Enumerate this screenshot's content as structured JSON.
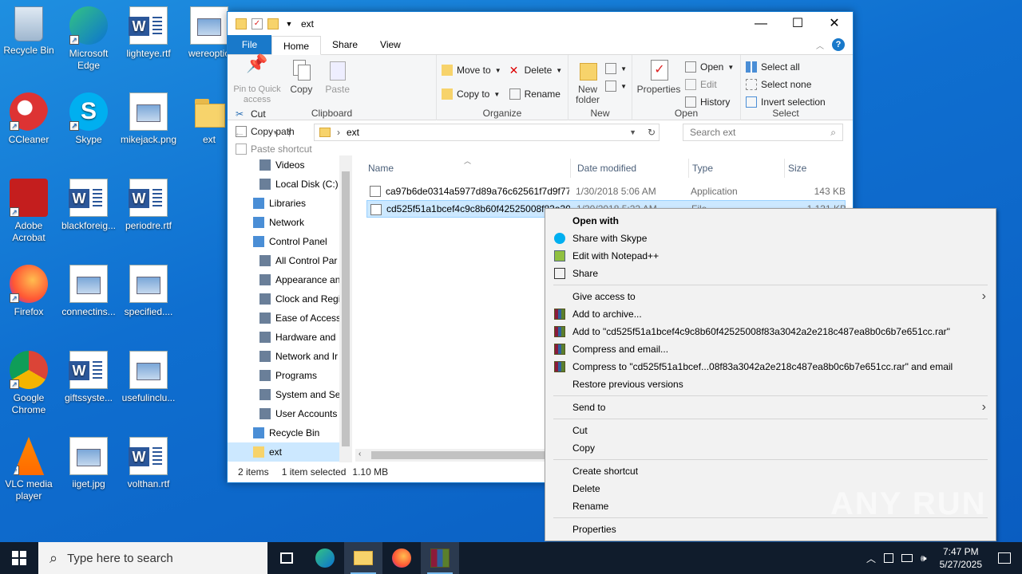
{
  "desktop": {
    "icons": [
      {
        "label": "Recycle Bin",
        "icon": "recycle-bin-icon"
      },
      {
        "label": "Microsoft Edge",
        "icon": "edge-icon"
      },
      {
        "label": "lighteye.rtf",
        "icon": "word-doc-icon"
      },
      {
        "label": "wereoptio",
        "icon": "image-file-icon"
      },
      {
        "label": "CCleaner",
        "icon": "ccleaner-icon"
      },
      {
        "label": "Skype",
        "icon": "skype-icon"
      },
      {
        "label": "mikejack.png",
        "icon": "image-file-icon"
      },
      {
        "label": "ext",
        "icon": "folder-icon"
      },
      {
        "label": "Adobe Acrobat",
        "icon": "acrobat-icon"
      },
      {
        "label": "blackforeig...",
        "icon": "word-doc-icon"
      },
      {
        "label": "periodre.rtf",
        "icon": "word-doc-icon"
      },
      {
        "label": "Firefox",
        "icon": "firefox-icon"
      },
      {
        "label": "connectins...",
        "icon": "image-file-icon"
      },
      {
        "label": "specified....",
        "icon": "image-file-icon"
      },
      {
        "label": "Google Chrome",
        "icon": "chrome-icon"
      },
      {
        "label": "giftssyste...",
        "icon": "word-doc-icon"
      },
      {
        "label": "usefulinclu...",
        "icon": "image-file-icon"
      },
      {
        "label": "VLC media player",
        "icon": "vlc-icon"
      },
      {
        "label": "iiget.jpg",
        "icon": "image-file-icon"
      },
      {
        "label": "volthan.rtf",
        "icon": "word-doc-icon"
      }
    ]
  },
  "explorer": {
    "title": "ext",
    "tabs": {
      "file": "File",
      "home": "Home",
      "share": "Share",
      "view": "View"
    },
    "ribbon": {
      "clipboard": {
        "name": "Clipboard",
        "pin": "Pin to Quick access",
        "copy": "Copy",
        "paste": "Paste",
        "cut": "Cut",
        "copy_path": "Copy path",
        "paste_shortcut": "Paste shortcut"
      },
      "organize": {
        "name": "Organize",
        "move_to": "Move to",
        "copy_to": "Copy to",
        "delete": "Delete",
        "rename": "Rename"
      },
      "new": {
        "name": "New",
        "new_folder": "New folder"
      },
      "open": {
        "name": "Open",
        "properties": "Properties",
        "open": "Open",
        "edit": "Edit",
        "history": "History"
      },
      "select": {
        "name": "Select",
        "select_all": "Select all",
        "select_none": "Select none",
        "invert": "Invert selection"
      }
    },
    "address": {
      "path": "ext",
      "search_placeholder": "Search ext"
    },
    "nav": [
      {
        "label": "Videos",
        "indent": 1
      },
      {
        "label": "Local Disk (C:)",
        "indent": 1
      },
      {
        "label": "Libraries",
        "indent": 0
      },
      {
        "label": "Network",
        "indent": 0
      },
      {
        "label": "Control Panel",
        "indent": 0
      },
      {
        "label": "All Control Par",
        "indent": 1
      },
      {
        "label": "Appearance an",
        "indent": 1
      },
      {
        "label": "Clock and Regi",
        "indent": 1
      },
      {
        "label": "Ease of Access",
        "indent": 1
      },
      {
        "label": "Hardware and",
        "indent": 1
      },
      {
        "label": "Network and Ir",
        "indent": 1
      },
      {
        "label": "Programs",
        "indent": 1
      },
      {
        "label": "System and Se",
        "indent": 1
      },
      {
        "label": "User Accounts",
        "indent": 1
      },
      {
        "label": "Recycle Bin",
        "indent": 0
      },
      {
        "label": "ext",
        "indent": 0
      }
    ],
    "columns": {
      "name": "Name",
      "date": "Date modified",
      "type": "Type",
      "size": "Size"
    },
    "files": [
      {
        "name": "ca97b6de0314a5977d89a76c62561f7d9f77...",
        "date": "1/30/2018 5:06 AM",
        "type": "Application",
        "size": "143 KB"
      },
      {
        "name": "cd525f51a1bcef4c9c8b60f42525008f83a30...",
        "date": "1/30/2018 5:22 AM",
        "type": "File",
        "size": "1,131 KB"
      }
    ],
    "status": {
      "items": "2 items",
      "selected": "1 item selected",
      "size": "1.10 MB"
    }
  },
  "context_menu": {
    "items": [
      {
        "label": "Open with",
        "bold": true
      },
      {
        "label": "Share with Skype",
        "icon": "skype-icon"
      },
      {
        "label": "Edit with Notepad++",
        "icon": "notepadpp-icon"
      },
      {
        "label": "Share",
        "icon": "share-icon"
      },
      {
        "sep": true
      },
      {
        "label": "Give access to",
        "submenu": true
      },
      {
        "label": "Add to archive...",
        "icon": "winrar-icon"
      },
      {
        "label": "Add to \"cd525f51a1bcef4c9c8b60f42525008f83a3042a2e218c487ea8b0c6b7e651cc.rar\"",
        "icon": "winrar-icon"
      },
      {
        "label": "Compress and email...",
        "icon": "winrar-icon"
      },
      {
        "label": "Compress to \"cd525f51a1bcef...08f83a3042a2e218c487ea8b0c6b7e651cc.rar\" and email",
        "icon": "winrar-icon"
      },
      {
        "label": "Restore previous versions"
      },
      {
        "sep": true
      },
      {
        "label": "Send to",
        "submenu": true
      },
      {
        "sep": true
      },
      {
        "label": "Cut"
      },
      {
        "label": "Copy"
      },
      {
        "sep": true
      },
      {
        "label": "Create shortcut"
      },
      {
        "label": "Delete"
      },
      {
        "label": "Rename"
      },
      {
        "sep": true
      },
      {
        "label": "Properties"
      }
    ]
  },
  "taskbar": {
    "search_placeholder": "Type here to search",
    "time": "7:47 PM",
    "date": "5/27/2025"
  },
  "watermark": "ANY RUN",
  "colors": {
    "accent": "#1979ca",
    "selection": "#cce8ff",
    "taskbar": "#101c2c"
  }
}
